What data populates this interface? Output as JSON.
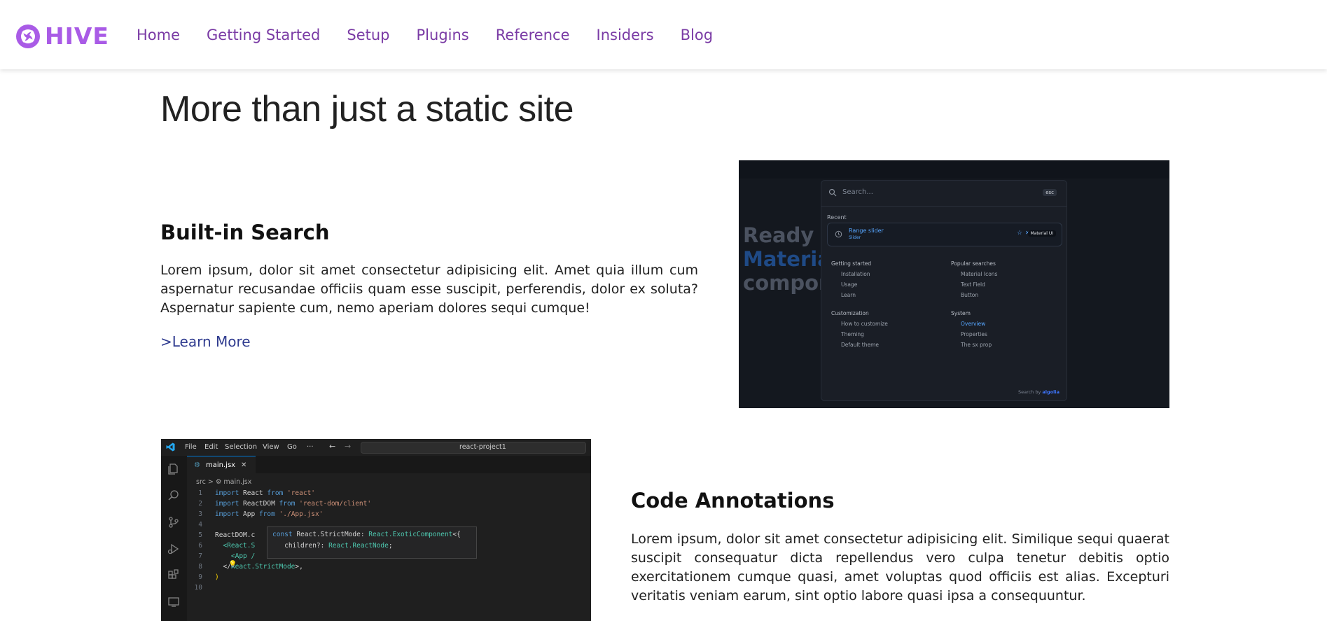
{
  "brand": {
    "name": "HIVE",
    "color": "#a95be6"
  },
  "nav": {
    "links": [
      "Home",
      "Getting Started",
      "Setup",
      "Plugins",
      "Reference",
      "Insiders",
      "Blog"
    ],
    "link_color": "#7a3ba5"
  },
  "main": {
    "title": "More than just a static site",
    "features": [
      {
        "heading": "Built-in Search",
        "text": "Lorem ipsum, dolor sit amet consectetur adipisicing elit. Amet quia illum cum aspernatur recusandae officiis quam esse suscipit, perferendis, dolor ex soluta? Aspernatur sapiente cum, nemo aperiam dolores sequi cumque!",
        "link": ">Learn More"
      },
      {
        "heading": "Code Annotations",
        "text": "Lorem ipsum, dolor sit amet consectetur adipisicing elit. Similique sequi quaerat suscipit consequatur dicta repellendus vero culpa tenetur debitis optio exercitationem cumque quasi, amet voluptas quod officiis est alias. Excepturi veritatis veniam earum, sint optio labore quasi ipsa a consequuntur."
      }
    ]
  },
  "search_shot": {
    "hero_line1": "Ready to",
    "hero_line2": "Material",
    "hero_line3": "compone",
    "placeholder": "Search...",
    "esc": "esc",
    "recent_label": "Recent",
    "recent_title": "Range slider",
    "recent_sub": "Slider",
    "recent_tag": "Material UI",
    "col1": {
      "heading": "Getting started",
      "items": [
        "Installation",
        "Usage",
        "Learn"
      ]
    },
    "col2": {
      "heading": "Popular searches",
      "items": [
        "Material Icons",
        "Text Field",
        "Button"
      ]
    },
    "col3": {
      "heading": "Customization",
      "items": [
        "How to customize",
        "Theming",
        "Default theme"
      ]
    },
    "col4": {
      "heading": "System",
      "items": [
        "Overview",
        "Properties",
        "The sx prop"
      ]
    },
    "search_by": "Search by",
    "algolia": "algolia"
  },
  "code_shot": {
    "menus": [
      "File",
      "Edit",
      "Selection",
      "View",
      "Go",
      "···"
    ],
    "search": "react-project1",
    "tab": "main.jsx",
    "tab_close": "✕",
    "breadcrumb": "src > ⚙ main.jsx",
    "lines": {
      "l1": {
        "n": "1",
        "a": "import",
        "b": " React ",
        "c": "from",
        "d": " 'react'"
      },
      "l2": {
        "n": "2",
        "a": "import",
        "b": " ReactDOM ",
        "c": "from",
        "d": " 'react-dom/client'"
      },
      "l3": {
        "n": "3",
        "a": "import",
        "b": " App ",
        "c": "from",
        "d": " './App.jsx'"
      },
      "l4": {
        "n": "4"
      },
      "l5": {
        "n": "5",
        "a": "ReactDOM.c"
      },
      "l6": {
        "n": "6",
        "a": "  <React.S"
      },
      "l7": {
        "n": "7",
        "a": "    <App /"
      },
      "l8": {
        "n": "8",
        "a": "  </",
        "b": "React.StrictMode",
        "c": ">,"
      },
      "l9": {
        "n": "9",
        "a": ")"
      },
      "l10": {
        "n": "10"
      }
    },
    "tooltip": {
      "kw": "const",
      "id": " React.StrictMode: ",
      "ty": "React.ExoticComponent",
      "rest": "<{",
      "line2a": "   children?: ",
      "line2b": "React.ReactNode",
      "line2c": ";",
      "line3": "}>"
    }
  }
}
